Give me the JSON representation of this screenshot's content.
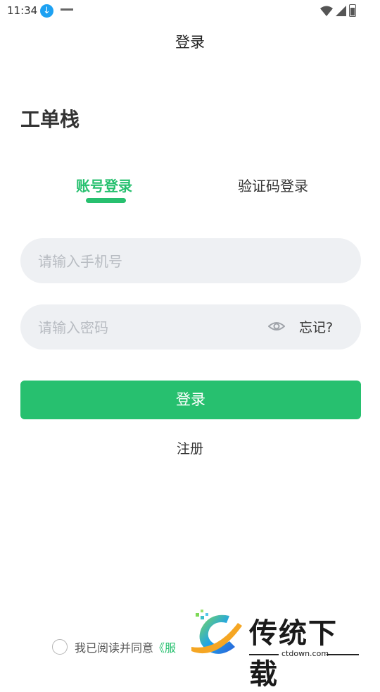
{
  "status_bar": {
    "time": "11:34",
    "download_icon": "download-icon",
    "icons": [
      "wifi-icon",
      "signal-icon",
      "battery-icon"
    ]
  },
  "header": {
    "title": "登录"
  },
  "app": {
    "name": "工单栈"
  },
  "tabs": [
    {
      "label": "账号登录",
      "active": true
    },
    {
      "label": "验证码登录",
      "active": false
    }
  ],
  "form": {
    "phone": {
      "value": "",
      "placeholder": "请输入手机号"
    },
    "password": {
      "value": "",
      "placeholder": "请输入密码"
    },
    "forgot_label": "忘记?",
    "login_label": "登录",
    "register_label": "注册"
  },
  "agreement": {
    "text": "我已阅读并同意",
    "link": "《服"
  },
  "watermark": {
    "brand": "传统下载",
    "url": "ctdown.com"
  },
  "colors": {
    "accent": "#27c06f",
    "field_bg": "#eef0f3",
    "text": "#333333",
    "placeholder": "#b8bcc2"
  }
}
